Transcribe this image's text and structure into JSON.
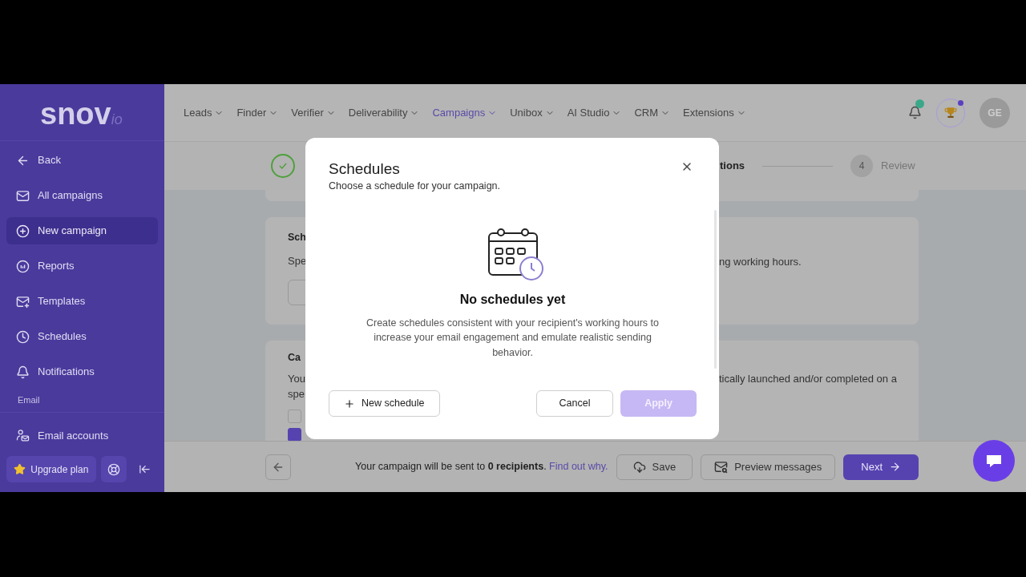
{
  "logo": {
    "name": "snov",
    "suffix": "io"
  },
  "sidebar": {
    "items": [
      {
        "label": "Back",
        "selected": false
      },
      {
        "label": "All campaigns",
        "selected": false
      },
      {
        "label": "New campaign",
        "selected": true
      },
      {
        "label": "Reports",
        "selected": false
      },
      {
        "label": "Templates",
        "selected": false
      },
      {
        "label": "Schedules",
        "selected": false
      },
      {
        "label": "Notifications",
        "selected": false
      }
    ],
    "section": {
      "title": "Email",
      "items": [
        {
          "label": "Email accounts",
          "selected": false
        }
      ]
    },
    "upgrade_button": "Upgrade plan"
  },
  "nav": [
    {
      "label": "Leads",
      "selected": false
    },
    {
      "label": "Finder",
      "selected": false
    },
    {
      "label": "Verifier",
      "selected": false
    },
    {
      "label": "Deliverability",
      "selected": false
    },
    {
      "label": "Campaigns",
      "selected": true
    },
    {
      "label": "Unibox",
      "selected": false
    },
    {
      "label": "AI Studio",
      "selected": false
    },
    {
      "label": "CRM",
      "selected": false
    },
    {
      "label": "Extensions",
      "selected": false
    }
  ],
  "header": {
    "notifications_unread": true,
    "rewards_unread": true,
    "avatar": "GE"
  },
  "steps": [
    {
      "kind": "done"
    },
    {
      "kind": "label",
      "label": "tions"
    },
    {
      "kind": "number",
      "number": "4",
      "label": "Review"
    }
  ],
  "cards": [
    {
      "title": "Sch",
      "left_lines": [
        "Spe"
      ],
      "has_button": true,
      "right_text": "ng working hours."
    },
    {
      "title": "Ca",
      "left_lines": [
        "You",
        "spe"
      ],
      "right_text": "tically launched and/or completed on a",
      "checkboxes": [
        {
          "checked": false
        },
        {
          "checked": true
        }
      ]
    }
  ],
  "footer": {
    "message": "Your campaign will be sent to **0 recipients**.",
    "link": "Find out why.",
    "buttons": [
      {
        "kind": "back"
      },
      {
        "kind": "save",
        "label": "Save"
      },
      {
        "kind": "preview",
        "label": "Preview messages"
      },
      {
        "kind": "next",
        "label": "Next"
      }
    ]
  },
  "modal": {
    "title": "Schedules",
    "subtitle": "Choose a schedule for your campaign.",
    "empty_title": "No schedules yet",
    "empty_text": "Create schedules consistent with your recipient's working hours to increase your email engagement and emulate realistic sending behavior.",
    "new_button": "New schedule",
    "cancel_button": "Cancel",
    "apply": {
      "label": "Apply",
      "disabled": true
    }
  }
}
